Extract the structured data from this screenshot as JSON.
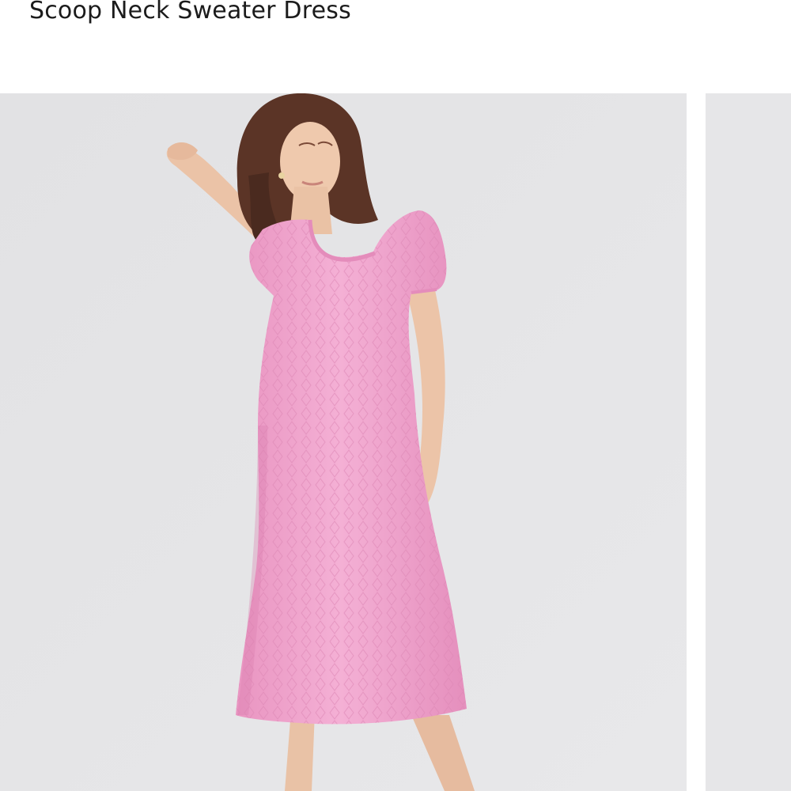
{
  "product": {
    "title": "Scoop Neck Sweater Dress"
  },
  "gallery": {
    "images": [
      {
        "subject": "model-wearing-pink-pointelle-knit-midi-dress",
        "background": "#e4e4e6"
      },
      {
        "subject": "next-product-photo-partially-visible",
        "background": "#e6e6e8"
      }
    ]
  },
  "colors": {
    "title_text": "#1b1b1b",
    "dress_pink": "#f0a6cf",
    "photo_background": "#e4e4e6"
  }
}
